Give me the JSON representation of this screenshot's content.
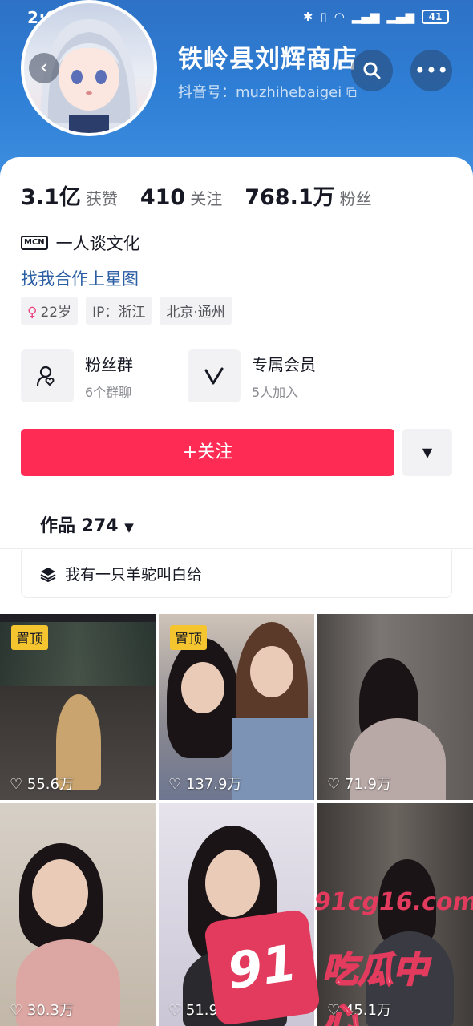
{
  "status": {
    "time": "2:07",
    "battery": "41",
    "icons": [
      "bluetooth-icon",
      "vibrate-icon",
      "wifi-icon",
      "signal-4g-icon",
      "signal-5g-icon",
      "battery-icon"
    ]
  },
  "profile": {
    "name": "铁岭县刘辉商店",
    "douyin_id": "抖音号：muzhihebaigei",
    "avatar": "anime-girl-avatar"
  },
  "stats": [
    {
      "num": "3.1亿",
      "label": "获赞"
    },
    {
      "num": "410",
      "label": "关注"
    },
    {
      "num": "768.1万",
      "label": "粉丝"
    }
  ],
  "mcn": {
    "badge": "MCN",
    "text": "一人谈文化"
  },
  "cooperation": "找我合作上星图",
  "tags": [
    "22岁",
    "IP：浙江",
    "北京·通州"
  ],
  "features": [
    {
      "title": "粉丝群",
      "sub": "6个群聊",
      "icon": "fan-group-icon"
    },
    {
      "title": "专属会员",
      "sub": "5人加入",
      "icon": "vip-v-icon"
    }
  ],
  "follow_label": "+关注",
  "works": {
    "label": "作品 274"
  },
  "collection": "我有一只羊驼叫白给",
  "videos": [
    {
      "likes": "55.6万",
      "pinned": "置顶"
    },
    {
      "likes": "137.9万",
      "pinned": "置顶"
    },
    {
      "likes": "71.9万",
      "pinned": ""
    },
    {
      "likes": "30.3万",
      "pinned": ""
    },
    {
      "likes": "51.9万",
      "pinned": ""
    },
    {
      "likes": "45.1万",
      "pinned": ""
    }
  ],
  "watermark": {
    "url": "91cg16.com",
    "num": "91",
    "text": "吃瓜中心"
  },
  "colors": {
    "header": "#2f7fd6",
    "follow": "#fe2c55",
    "link": "#2b5ea3",
    "pin": "#f5c530"
  }
}
